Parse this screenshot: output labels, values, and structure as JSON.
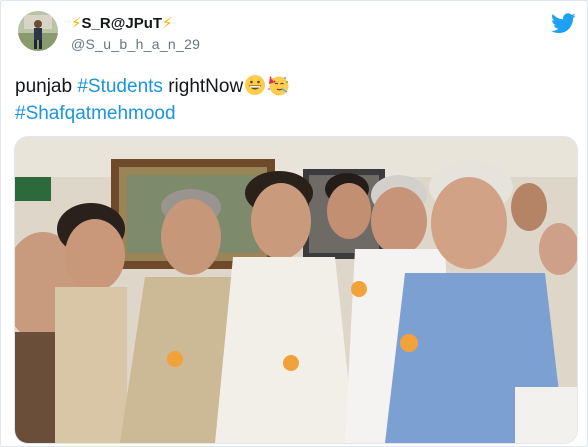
{
  "tweet": {
    "author": {
      "bolt_left": "⚡",
      "display_name": "S_R@JPuT",
      "bolt_right": "⚡",
      "handle": "@S_u_b_h_a_n_29"
    },
    "text": {
      "line1_plain_a": "punjab ",
      "line1_hashtag": "#Students",
      "line1_plain_b": " rightNow",
      "emoji_1": "grinning-face",
      "emoji_2": "partying-face",
      "line2_hashtag": "#Shafqatmehmood"
    },
    "icons": {
      "platform": "twitter-bird-icon"
    },
    "colors": {
      "link": "#1b95e0",
      "bird": "#1da1f2",
      "handle": "#657786",
      "text": "#14171a"
    }
  }
}
